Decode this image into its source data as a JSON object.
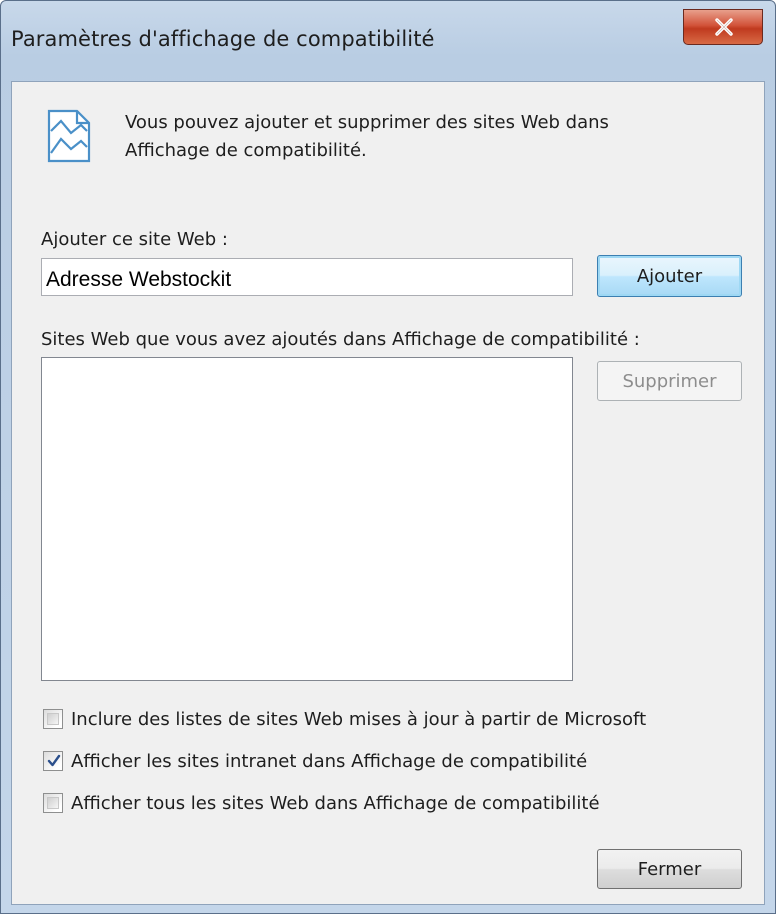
{
  "window": {
    "title": "Paramètres d'affichage de compatibilité"
  },
  "info": {
    "icon": "compatibility-view-icon",
    "text_line1": "Vous pouvez ajouter et supprimer des sites Web dans",
    "text_line2": "Affichage de compatibilité."
  },
  "add_site": {
    "label": "Ajouter ce site Web :",
    "input_value": "Adresse Webstockit",
    "add_button": "Ajouter"
  },
  "sites_list": {
    "label": "Sites Web que vous avez ajoutés dans Affichage de compatibilité :",
    "items": [],
    "remove_button": "Supprimer"
  },
  "options": [
    {
      "label": "Inclure des listes de sites Web mises à jour à partir de Microsoft",
      "checked": false
    },
    {
      "label": "Afficher les sites intranet dans Affichage de compatibilité",
      "checked": true
    },
    {
      "label": "Afficher tous les sites Web dans Affichage de compatibilité",
      "checked": false
    }
  ],
  "footer": {
    "close_button": "Fermer"
  },
  "colors": {
    "title_bar": "#c8d8ea",
    "close_button": "#c9462a",
    "dialog_bg": "#f0f0f0",
    "default_button": "#bee6fd"
  }
}
